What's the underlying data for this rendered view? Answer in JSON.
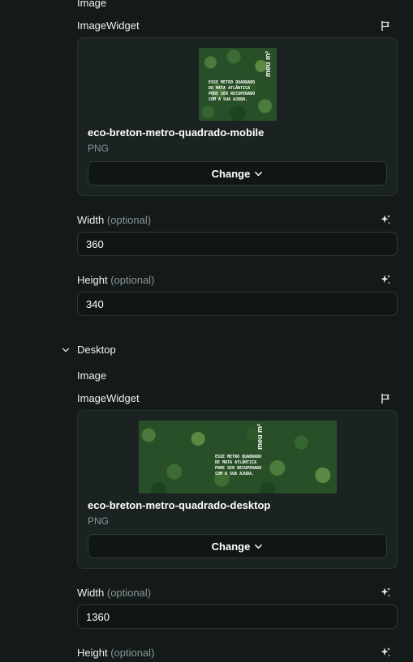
{
  "mobile": {
    "section_label": "Image",
    "widget_label": "ImageWidget",
    "image": {
      "name": "eco-breton-metro-quadrado-mobile",
      "type": "PNG",
      "caption_lines": [
        "ESSE METRO QUADRADO",
        "DE MATA ATLÂNTICA",
        "PODE SER RECUPERADO",
        "COM A SUA AJUDA."
      ],
      "brand": "meu m²"
    },
    "change_label": "Change",
    "width_label": "Width",
    "width_optional": "(optional)",
    "width_value": "360",
    "height_label": "Height",
    "height_optional": "(optional)",
    "height_value": "340"
  },
  "desktop": {
    "group_label": "Desktop",
    "section_label": "Image",
    "widget_label": "ImageWidget",
    "image": {
      "name": "eco-breton-metro-quadrado-desktop",
      "type": "PNG",
      "caption_lines": [
        "ESSE METRO QUADRADO",
        "DE MATA ATLÂNTICA",
        "PODE SER RECUPERADO",
        "COM A SUA AJUDA."
      ],
      "brand": "meu m²"
    },
    "change_label": "Change",
    "width_label": "Width",
    "width_optional": "(optional)",
    "width_value": "1360",
    "height_label": "Height",
    "height_optional": "(optional)"
  },
  "colors": {
    "background": "#141a1a",
    "card": "#1a2222",
    "border": "#2f3939",
    "muted_text": "#8b9696",
    "forest": "#2f5a2c"
  },
  "icons": [
    "flag-icon",
    "sparkle-icon",
    "chevron-down-icon"
  ]
}
